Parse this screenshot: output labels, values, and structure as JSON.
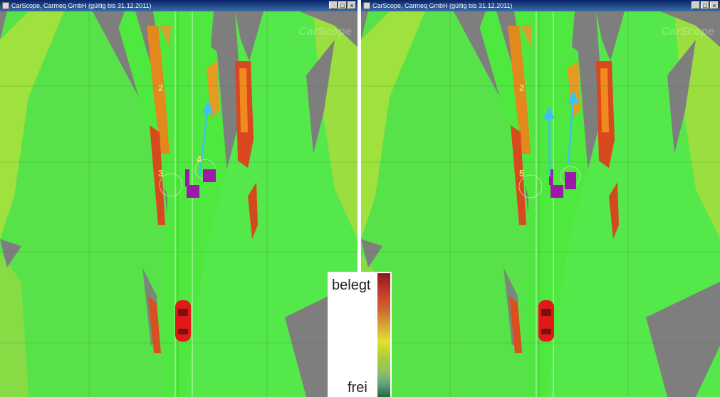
{
  "left_window": {
    "title": "CarScope, Carmeq GmbH (gültig bis 31.12.2011)",
    "controls": {
      "minimize": "_",
      "maximize": "□",
      "close": "×"
    },
    "watermark": "CarScope",
    "track_labels": [
      "2",
      "3",
      "4"
    ]
  },
  "right_window": {
    "title": "CarScope, Carmeq GmbH (gültig bis 31.12.2011)",
    "controls": {
      "minimize": "_",
      "maximize": "□",
      "close": "×"
    },
    "watermark": "CarScope",
    "track_labels": [
      "2",
      "5"
    ]
  },
  "legend": {
    "top_label": "belegt",
    "bottom_label": "frei"
  },
  "colors": {
    "free": "#4ce64c",
    "occupied": "#d23a1e",
    "unknown": "#7e7e7e",
    "object": "#9b1aa8",
    "velocity_arrow": "#3fc1ef",
    "vehicle": "#e01818"
  }
}
